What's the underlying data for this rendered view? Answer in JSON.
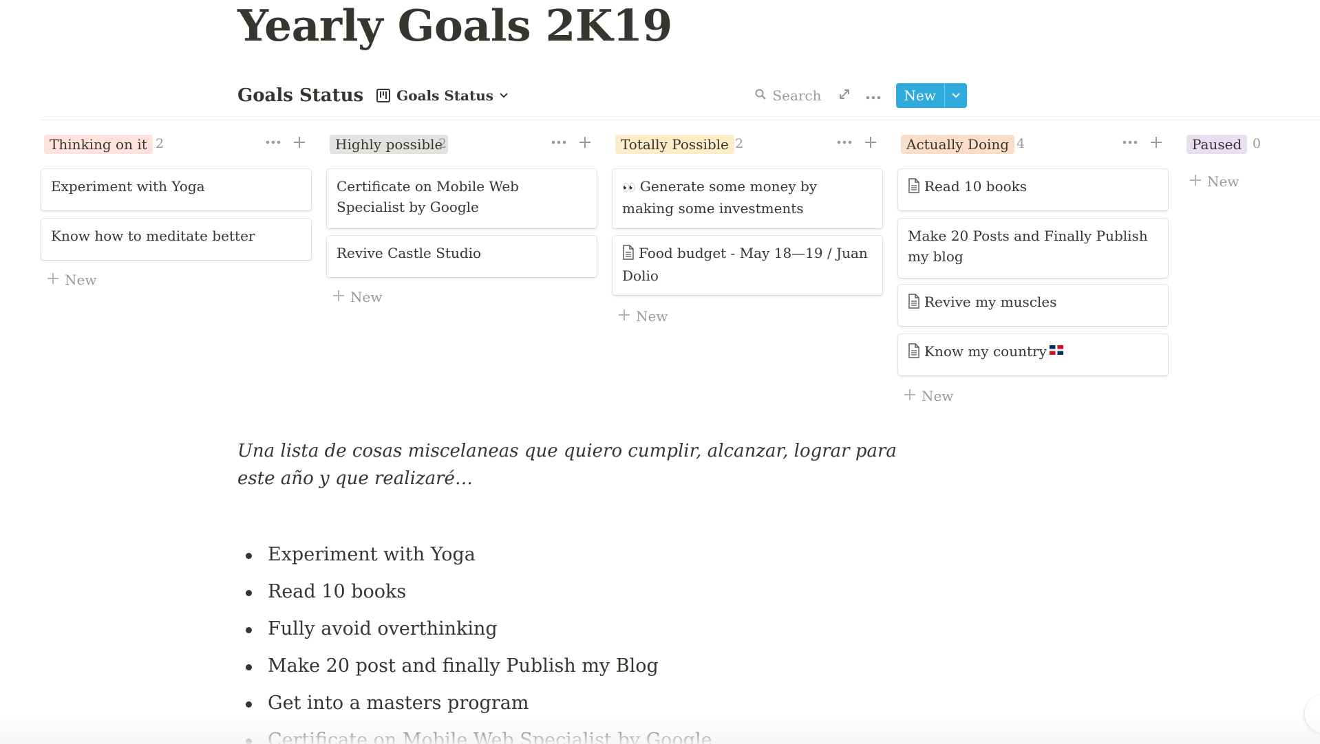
{
  "page": {
    "title": "Yearly Goals 2K19"
  },
  "database": {
    "title": "Goals Status",
    "view_label": "Goals Status",
    "search_label": "Search",
    "new_label": "New",
    "view_icon": "board-icon",
    "accent": "#2eaadc"
  },
  "board": {
    "add_new_label": "New",
    "columns": [
      {
        "name": "Thinking on it",
        "count": "2",
        "tag_bg": "#ffe2dd",
        "cards": [
          {
            "title": "Experiment with Yoga",
            "icon": null
          },
          {
            "title": "Know how to meditate better",
            "icon": null
          }
        ]
      },
      {
        "name": "Highly possible",
        "count": "2",
        "tag_bg": "#e3e2e0",
        "cards": [
          {
            "title": "Certificate on Mobile Web Specialist by Google",
            "icon": null
          },
          {
            "title": "Revive Castle Studio",
            "icon": null
          }
        ]
      },
      {
        "name": "Totally Possible",
        "count": "2",
        "tag_bg": "#fdecc8",
        "cards": [
          {
            "title": "Generate some money by making some investments",
            "icon": "eyes-icon"
          },
          {
            "title": "Food budget - May 18—19 / Juan Dolio",
            "icon": "page-icon"
          }
        ]
      },
      {
        "name": "Actually Doing",
        "count": "4",
        "tag_bg": "#fadec9",
        "cards": [
          {
            "title": "Read 10 books",
            "icon": "page-icon"
          },
          {
            "title": "Make 20 Posts and Finally Publish my blog",
            "icon": null
          },
          {
            "title": "Revive my muscles",
            "icon": "page-icon"
          },
          {
            "title": "Know my country",
            "icon": "page-icon",
            "suffix_icon": "dominican-flag-icon"
          }
        ]
      },
      {
        "name": "Paused",
        "count": "0",
        "tag_bg": "#e8deee",
        "cards": []
      }
    ]
  },
  "description": "Una lista de cosas miscelaneas que quiero cumplir, alcanzar, lograr para este año y que realizaré…",
  "goals_list": [
    "Experiment with Yoga",
    "Read 10 books",
    "Fully avoid overthinking",
    "Make 20 post and finally Publish my Blog",
    "Get into a masters program",
    "Certificate on Mobile Web Specialist by Google"
  ]
}
